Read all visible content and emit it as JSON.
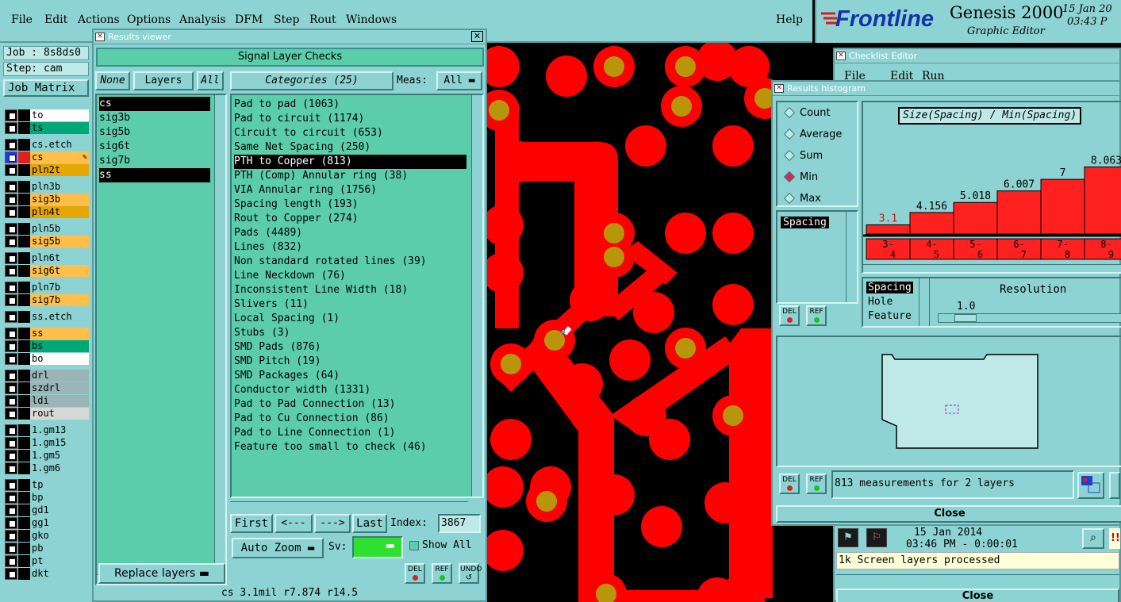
{
  "menu": {
    "items": [
      "File",
      "Edit",
      "Actions",
      "Options",
      "Analysis",
      "DFM",
      "Step",
      "Rout",
      "Windows"
    ],
    "help": "Help"
  },
  "brand": {
    "logo": "Frontline",
    "product": "Genesis 2000",
    "subtitle": "Graphic Editor",
    "date": "15 Jan 20",
    "time": "03:43 P"
  },
  "job": {
    "job": "Job : 8s8ds0",
    "step": "Step: cam",
    "matrix_button": "Job Matrix"
  },
  "layers": [
    {
      "name": "to",
      "color": "#ffffff"
    },
    {
      "name": "ts",
      "color": "#00a878"
    },
    {
      "name": "cs.etch",
      "color": "#8ed3d3"
    },
    {
      "name": "cs",
      "color": "#ffbf4a",
      "active": true
    },
    {
      "name": "pln2t",
      "color": "#e8a600"
    },
    {
      "name": "pln3b",
      "color": "#8ed3d3"
    },
    {
      "name": "sig3b",
      "color": "#ffbf4a"
    },
    {
      "name": "pln4t",
      "color": "#e8a600"
    },
    {
      "name": "pln5b",
      "color": "#8ed3d3"
    },
    {
      "name": "sig5b",
      "color": "#ffbf4a"
    },
    {
      "name": "pln6t",
      "color": "#8ed3d3"
    },
    {
      "name": "sig6t",
      "color": "#ffbf4a"
    },
    {
      "name": "pln7b",
      "color": "#8ed3d3"
    },
    {
      "name": "sig7b",
      "color": "#ffbf4a"
    },
    {
      "name": "ss.etch",
      "color": "#8ed3d3"
    },
    {
      "name": "ss",
      "color": "#ffbf4a"
    },
    {
      "name": "bs",
      "color": "#00a878"
    },
    {
      "name": "bo",
      "color": "#ffffff"
    },
    {
      "name": "drl",
      "color": "#9ab4b8"
    },
    {
      "name": "szdrl",
      "color": "#9ab4b8"
    },
    {
      "name": "ldi",
      "color": "#9ab4b8"
    },
    {
      "name": "rout",
      "color": "#d8d8d8"
    },
    {
      "name": "1.gm13",
      "color": "#8ed3d3"
    },
    {
      "name": "1.gm15",
      "color": "#8ed3d3"
    },
    {
      "name": "1.gm5",
      "color": "#8ed3d3"
    },
    {
      "name": "1.gm6",
      "color": "#8ed3d3"
    },
    {
      "name": "tp",
      "color": "#8ed3d3"
    },
    {
      "name": "bp",
      "color": "#8ed3d3"
    },
    {
      "name": "gd1",
      "color": "#8ed3d3"
    },
    {
      "name": "gg1",
      "color": "#8ed3d3"
    },
    {
      "name": "gko",
      "color": "#8ed3d3"
    },
    {
      "name": "pb",
      "color": "#8ed3d3"
    },
    {
      "name": "pt",
      "color": "#8ed3d3"
    },
    {
      "name": "dkt",
      "color": "#8ed3d3"
    }
  ],
  "results_viewer": {
    "window_title": "Results viewer",
    "title": "Signal Layer Checks",
    "none_btn": "None",
    "layers_btn": "Layers",
    "all_btn": "All",
    "layer_list": [
      "cs",
      "sig3b",
      "sig5b",
      "sig6t",
      "sig7b",
      "ss"
    ],
    "categories_btn": "Categories (25)",
    "meas_label": "Meas:",
    "meas_value": "All",
    "categories": [
      "Pad to pad (1063)",
      "Pad to circuit (1174)",
      "Circuit to circuit (653)",
      "Same Net Spacing (250)",
      "PTH to Copper (813)",
      "PTH (Comp) Annular ring (38)",
      "VIA Annular ring (1756)",
      "Spacing length (193)",
      "Rout to Copper (274)",
      "Pads (4489)",
      "Lines (832)",
      "Non standard rotated lines (39)",
      "Line Neckdown (76)",
      "Inconsistent Line Width (18)",
      "Slivers (11)",
      "Local Spacing (1)",
      "Stubs (3)",
      "SMD Pads (876)",
      "SMD Pitch (19)",
      "SMD Packages (64)",
      "Conductor width (1331)",
      "Pad to Pad Connection (13)",
      "Pad to Cu Connection (86)",
      "Pad to Line Connection (1)",
      "Feature too small to check (46)"
    ],
    "selected_index": 4,
    "nav": {
      "first": "First",
      "prev": "<---",
      "next": "--->",
      "last": "Last",
      "index_label": "Index:",
      "index_value": "3867"
    },
    "auto_zoom": "Auto Zoom",
    "sv_label": "Sv:",
    "show_all": "Show All",
    "replace_layers": "Replace layers",
    "del": "DEL",
    "ref": "REF",
    "undo": "UNDO",
    "status": "cs 3.1mil    r7.874   r14.5"
  },
  "checklist": {
    "window_title": "Checklist Editor",
    "menu": [
      "File",
      "Edit",
      "Run"
    ],
    "date": "15 Jan 2014",
    "time": "03:46 PM - 0:00:01",
    "message": "1k Screen layers processed",
    "close": "Close"
  },
  "histogram": {
    "window_title": "Results histogram",
    "modes": [
      "Count",
      "Average",
      "Sum",
      "Min",
      "Max"
    ],
    "selected_mode": 3,
    "chart_title": "Size(Spacing) / Min(Spacing)",
    "list": [
      "Spacing"
    ],
    "types": [
      "Spacing",
      "Hole",
      "Feature"
    ],
    "resolution_label": "Resolution",
    "resolution_value": "1.0",
    "summary": "813 measurements for 2 layers",
    "close": "Close",
    "del": "DEL",
    "ref": "REF"
  },
  "chart_data": {
    "type": "bar",
    "title": "Size(Spacing) / Min(Spacing)",
    "categories": [
      "3-4",
      "4-5",
      "5-6",
      "6-7",
      "7-8",
      "8-9"
    ],
    "values": [
      3.1,
      4.156,
      5.018,
      6.007,
      7,
      8.063
    ],
    "value_labels": [
      "3.1",
      "4.156",
      "5.018",
      "6.007",
      "7",
      "8.063"
    ],
    "ylim": [
      0,
      9
    ],
    "bar_color": "#ff2020"
  }
}
